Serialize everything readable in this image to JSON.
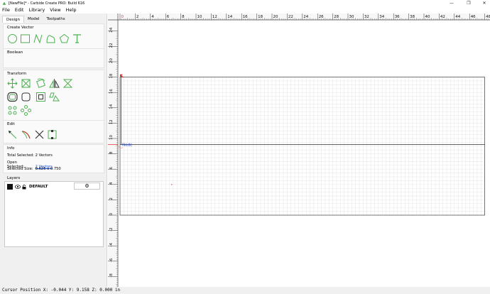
{
  "window": {
    "title": "[NewFile]* - Carbide Create PRO: Build 616",
    "controls": [
      "—",
      "❐",
      "✕"
    ]
  },
  "menu": [
    {
      "name": "menu-file",
      "label": "File"
    },
    {
      "name": "menu-edit",
      "label": "Edit"
    },
    {
      "name": "menu-library",
      "label": "Library"
    },
    {
      "name": "menu-view",
      "label": "View"
    },
    {
      "name": "menu-help",
      "label": "Help"
    }
  ],
  "tabs": [
    {
      "label": "Design",
      "active": true
    },
    {
      "label": "Model",
      "active": false
    },
    {
      "label": "Toolpaths",
      "active": false
    }
  ],
  "sections": {
    "create_vector": "Create Vector",
    "boolean": "Boolean",
    "transform": "Transform",
    "edit": "Edit",
    "info": "Info",
    "layers": "Layers"
  },
  "icons": {
    "color": "#4caf50",
    "create_vector": [
      "circle-icon",
      "rectangle-icon",
      "polyline-icon",
      "curve-icon",
      "polygon-icon",
      "text-icon"
    ],
    "transform": [
      "move-icon",
      "resize-icon",
      "rotate-icon",
      "mirror-icon",
      "align-icon",
      "offset-icon",
      "fillet-icon",
      "inset-icon",
      "distort-icon",
      "array-icon",
      "circular-array-icon"
    ],
    "edit": [
      "node-edit-icon",
      "trim-icon",
      "cut-icon",
      "join-icon"
    ]
  },
  "info": {
    "total_selected_label": "Total Selected:",
    "total_selected_value": "2 Vectors",
    "open_selected_label": "Open Selected:",
    "open_selected_value": "2 Vectors",
    "selected_size_label": "Selected Size:",
    "selected_size_value": "0.625 x 0.750"
  },
  "layers": [
    {
      "name": "DEFAULT",
      "color": "#111111",
      "settings_icon": "⚙"
    }
  ],
  "status": {
    "text": "Cursor Position X: -0.044 Y: 9.158 Z: 0.000 in"
  },
  "canvas": {
    "x_ticks": [
      "0",
      "2",
      "4",
      "6",
      "8",
      "10",
      "12",
      "14",
      "16",
      "18",
      "20",
      "22",
      "24",
      "26",
      "28",
      "30",
      "32",
      "34",
      "36",
      "38",
      "40",
      "42",
      "44",
      "46",
      "48"
    ],
    "y_ticks": [
      "24",
      "22",
      "20",
      "18",
      "16",
      "14",
      "12",
      "10",
      "8",
      "6",
      "4",
      "2",
      "0",
      "-2",
      "-4",
      "-6",
      "-8",
      "-10"
    ],
    "node_label": "Node",
    "stock_color": "#555555",
    "accent": "#e53935"
  }
}
